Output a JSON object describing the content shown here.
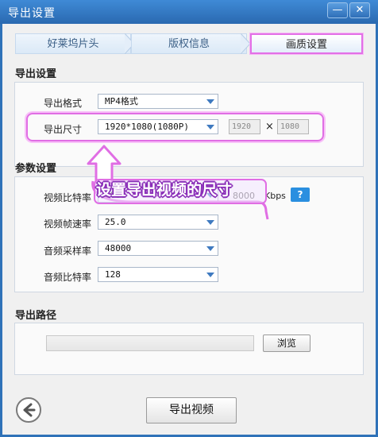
{
  "window": {
    "title": "导出设置",
    "min_glyph": "—",
    "close_glyph": "✕"
  },
  "tabs": [
    {
      "label": "好莱坞片头"
    },
    {
      "label": "版权信息"
    },
    {
      "label": "画质设置",
      "active": true
    }
  ],
  "export_settings": {
    "heading": "导出设置",
    "format_label": "导出格式",
    "format_value": "MP4格式",
    "size_label": "导出尺寸",
    "size_value": "1920*1080(1080P)",
    "width_value": "1920",
    "times": "×",
    "height_value": "1080"
  },
  "params": {
    "heading": "参数设置",
    "video_bitrate_label": "视频比特率",
    "video_bitrate_value": "8000",
    "video_bitrate_extra": "8000",
    "bitrate_unit": "Kbps",
    "help": "?",
    "framerate_label": "视频帧速率",
    "framerate_value": "25.0",
    "samplerate_label": "音频采样率",
    "samplerate_value": "48000",
    "audio_bitrate_label": "音频比特率",
    "audio_bitrate_value": "128"
  },
  "callout": {
    "text": "设置导出视频的尺寸"
  },
  "output": {
    "heading": "导出路径",
    "path_value": "",
    "browse_label": "浏览"
  },
  "actions": {
    "export_label": "导出视频"
  },
  "colors": {
    "title_bar": "#2f72b8",
    "highlight": "#e06ee4",
    "callout_outline": "#8a2fb8",
    "help_blue": "#2a8fe0"
  }
}
